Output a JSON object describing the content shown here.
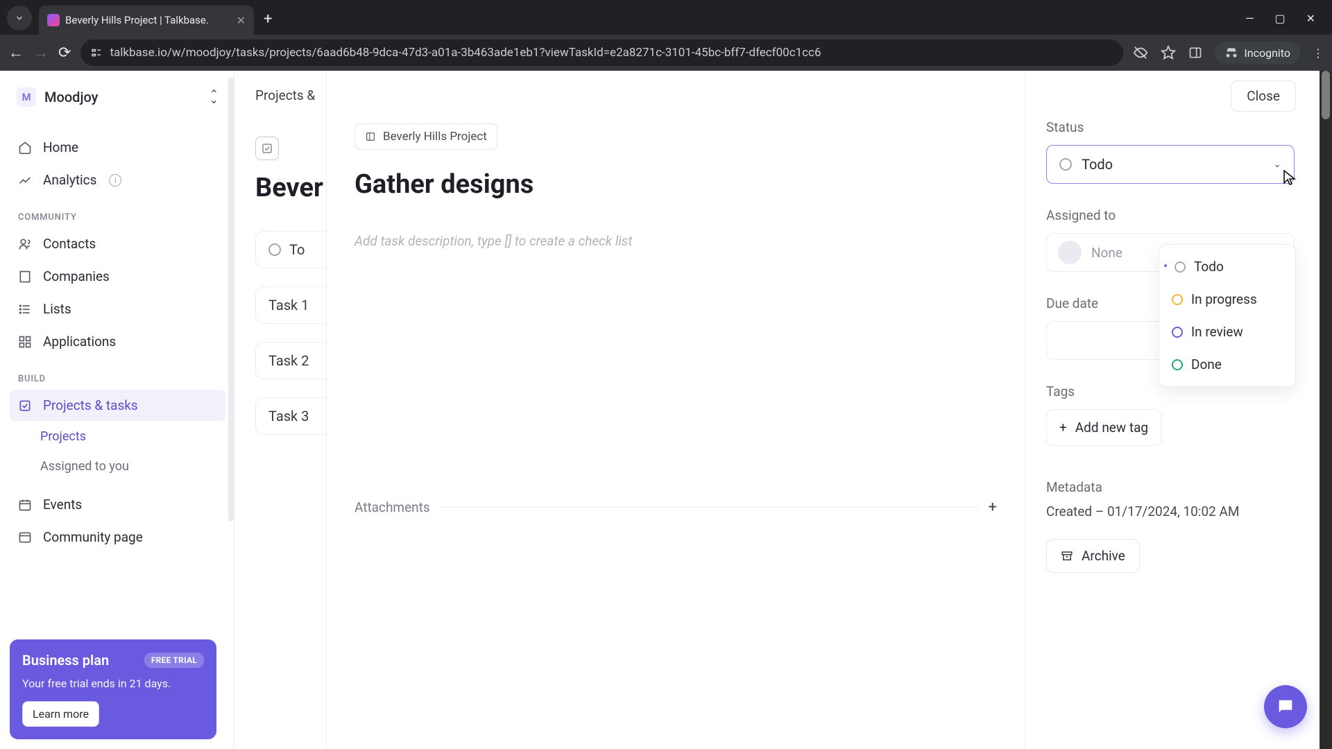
{
  "browser": {
    "tab_title": "Beverly Hills Project | Talkbase.",
    "url": "talkbase.io/w/moodjoy/tasks/projects/6aad6b48-9dca-47d3-a01a-3b463ade1eb1?viewTaskId=e2a8271c-3101-45bc-bff7-dfecf00c1cc6",
    "incognito_label": "Incognito"
  },
  "workspace": {
    "initial": "M",
    "name": "Moodjoy"
  },
  "nav": {
    "home": "Home",
    "analytics": "Analytics",
    "section_community": "COMMUNITY",
    "contacts": "Contacts",
    "companies": "Companies",
    "lists": "Lists",
    "applications": "Applications",
    "section_build": "BUILD",
    "projects_tasks": "Projects & tasks",
    "sub_projects": "Projects",
    "sub_assigned": "Assigned to you",
    "events": "Events",
    "community_page": "Community page"
  },
  "promo": {
    "title": "Business plan",
    "badge": "FREE TRIAL",
    "subtitle": "Your free trial ends in 21 days.",
    "cta": "Learn more"
  },
  "main": {
    "breadcrumb": "Projects &",
    "title_fragment": "Bever",
    "status_col": "To",
    "rows": [
      "Task 1",
      "Task 2",
      "Task 3"
    ]
  },
  "task": {
    "close": "Close",
    "project_chip": "Beverly Hills Project",
    "title": "Gather designs",
    "desc_placeholder": "Add task description, type [] to create a check list",
    "attachments_label": "Attachments"
  },
  "side": {
    "status_label": "Status",
    "status_value": "Todo",
    "options": {
      "todo": "Todo",
      "in_progress": "In progress",
      "in_review": "In review",
      "done": "Done"
    },
    "assigned_label": "Assigned to",
    "assigned_value": "None",
    "due_label": "Due date",
    "tags_label": "Tags",
    "add_tag": "Add new tag",
    "metadata_label": "Metadata",
    "created": "Created – 01/17/2024, 10:02 AM",
    "archive": "Archive"
  }
}
